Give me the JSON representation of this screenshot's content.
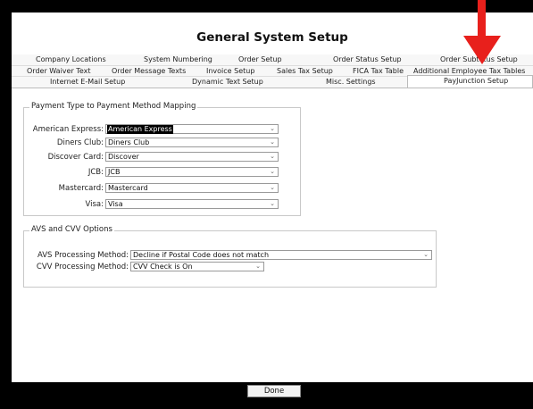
{
  "window": {
    "title": "General System Setup"
  },
  "tabs": {
    "row1": [
      "Company Locations",
      "System Numbering",
      "Order Setup",
      "Order Status Setup",
      "Order Subtotus Setup"
    ],
    "row2": [
      "Order Waiver Text",
      "Order Message Texts",
      "Invoice Setup",
      "Sales Tax Setup",
      "FICA Tax Table",
      "Additional Employee Tax Tables"
    ],
    "row3": [
      "Internet E-Mail Setup",
      "Dynamic Text Setup",
      "Misc. Settings",
      "PayJunction Setup"
    ],
    "active": "PayJunction Setup"
  },
  "mapping": {
    "legend": "Payment Type to Payment Method Mapping",
    "fields": [
      {
        "label": "American Express:",
        "value": "American Express",
        "icon": "chevron-down-icon"
      },
      {
        "label": "Diners Club:",
        "value": "Diners Club",
        "icon": "chevron-down-icon"
      },
      {
        "label": "Discover Card:",
        "value": "Discover",
        "icon": "chevron-down-icon"
      },
      {
        "label": "JCB:",
        "value": "JCB",
        "icon": "chevron-down-icon"
      },
      {
        "label": "Mastercard:",
        "value": "Mastercard",
        "icon": "chevron-down-icon"
      },
      {
        "label": "Visa:",
        "value": "Visa",
        "icon": "chevron-down-icon"
      }
    ]
  },
  "avs": {
    "legend": "AVS and CVV Options",
    "avs_label": "AVS Processing Method:",
    "avs_value": "Decline if Postal Code does not match",
    "cvv_label": "CVV Processing Method:",
    "cvv_value": "CVV Check is On"
  },
  "buttons": {
    "done": "Done"
  },
  "annotation": {
    "arrow_color": "#e8201c",
    "icon": "red-arrow-icon"
  },
  "glyphs": {
    "chevron": "⌄"
  }
}
